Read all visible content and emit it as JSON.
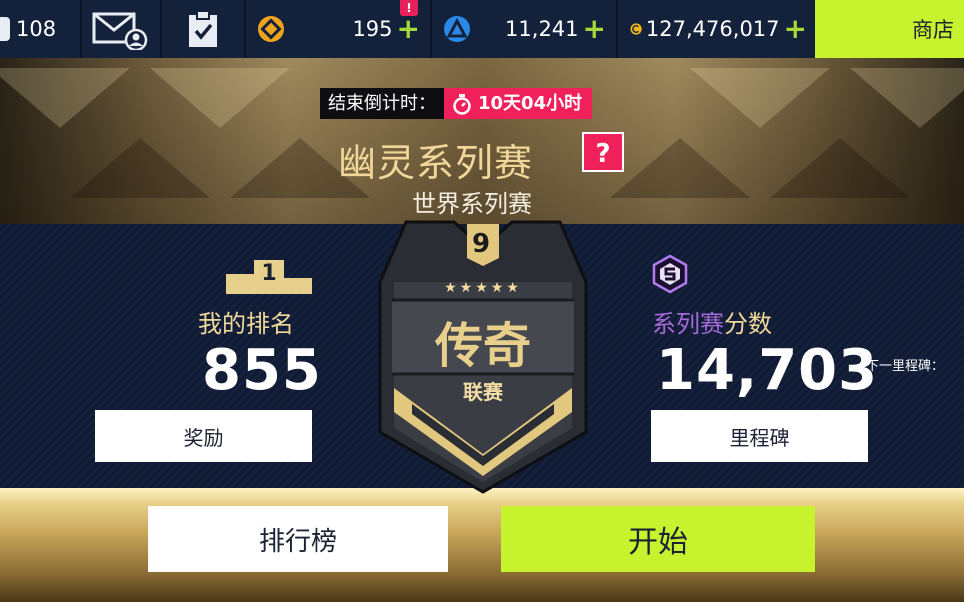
{
  "topbar": {
    "fuel_count": "108",
    "token_count": "195",
    "token_badge": "!",
    "blueprint_count": "11,241",
    "credits": "127,476,017",
    "plus_symbol": "+",
    "shop_label": "商店"
  },
  "event": {
    "countdown_label": "结束倒计时：",
    "countdown_value": "10天04小时",
    "title": "幽灵系列赛",
    "help_symbol": "?",
    "subtitle": "世界系列赛"
  },
  "rank": {
    "podium_number": "1",
    "label": "我的排名",
    "value": "855",
    "rewards_button": "奖励"
  },
  "league": {
    "tier_number": "9",
    "stars": "★★★★★",
    "name": "传奇",
    "suffix": "联赛"
  },
  "score": {
    "label_part1": "系列赛",
    "label_part2": "分数",
    "value": "14,703",
    "next_milestone_label": "下一里程碑：",
    "milestones_button": "里程碑"
  },
  "actions": {
    "leaderboard_button": "排行榜",
    "start_button": "开始"
  },
  "colors": {
    "accent_lime": "#c6f22e",
    "accent_pink": "#f0205a",
    "gold_text": "#f0d89a",
    "purple_text": "#a46ad8"
  }
}
